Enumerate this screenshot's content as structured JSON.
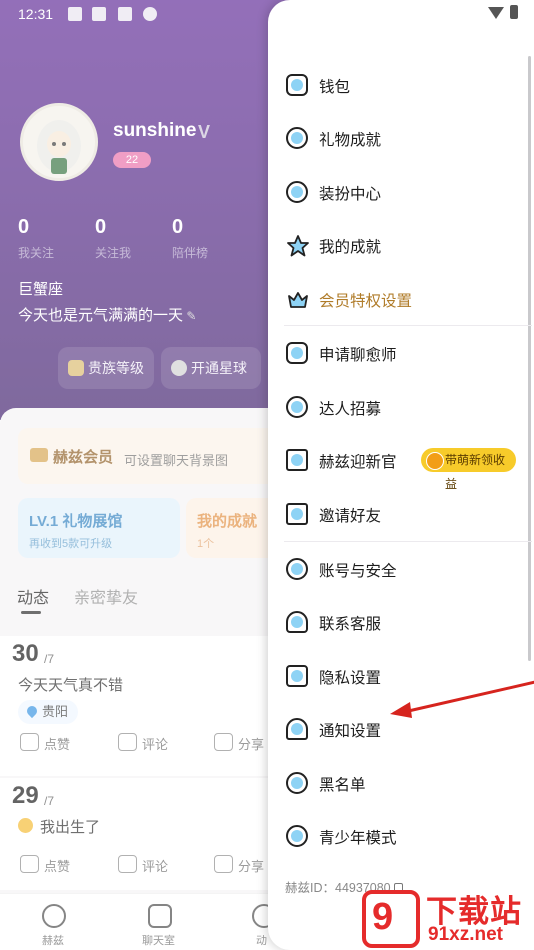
{
  "status_bar": {
    "time": "12:31"
  },
  "profile": {
    "username": "sunshine",
    "level_badge": "22",
    "stats": [
      {
        "value": "0",
        "label": "我关注"
      },
      {
        "value": "0",
        "label": "关注我"
      },
      {
        "value": "0",
        "label": "陪伴榜"
      }
    ],
    "zodiac": "巨蟹座",
    "bio": "今天也是元气满满的一天",
    "pills": [
      "贵族等级",
      "开通星球"
    ]
  },
  "cards": {
    "vip_title": "赫兹会员",
    "vip_sub": "可设置聊天背景图",
    "gift_title": "LV.1 礼物展馆",
    "gift_sub": "再收到5款可升级",
    "ach_title": "我的成就",
    "ach_sub": "1个"
  },
  "tabs": [
    "动态",
    "亲密挚友"
  ],
  "posts": [
    {
      "day": "30",
      "month": "/7",
      "text": "今天天气真不错",
      "location": "贵阳"
    },
    {
      "day": "29",
      "month": "/7",
      "text": "我出生了",
      "location": ""
    }
  ],
  "post_actions": [
    "点赞",
    "评论",
    "分享"
  ],
  "bottom_nav": [
    "赫兹",
    "聊天室",
    "动"
  ],
  "drawer": {
    "items": [
      {
        "label": "钱包",
        "icon": "wallet-icon"
      },
      {
        "label": "礼物成就",
        "icon": "gift-achievement-icon"
      },
      {
        "label": "装扮中心",
        "icon": "dressup-icon"
      },
      {
        "label": "我的成就",
        "icon": "star-icon"
      },
      {
        "label": "会员特权设置",
        "icon": "crown-icon"
      },
      {
        "label": "申请聊愈师",
        "icon": "heart-chat-icon"
      },
      {
        "label": "达人招募",
        "icon": "badge-icon"
      },
      {
        "label": "赫兹迎新官",
        "icon": "newcomer-icon",
        "tag": "带萌新领收益"
      },
      {
        "label": "邀请好友",
        "icon": "invite-icon"
      },
      {
        "label": "账号与安全",
        "icon": "account-icon"
      },
      {
        "label": "联系客服",
        "icon": "headset-icon"
      },
      {
        "label": "隐私设置",
        "icon": "lock-icon"
      },
      {
        "label": "通知设置",
        "icon": "bell-icon"
      },
      {
        "label": "黑名单",
        "icon": "blacklist-icon"
      },
      {
        "label": "青少年模式",
        "icon": "teen-icon"
      }
    ],
    "uid": "赫兹ID：44937080"
  },
  "watermark": {
    "logo": "9",
    "title": "下载站",
    "url": "91xz.net"
  },
  "colors": {
    "header": "#4a1e7e",
    "gold": "#b07c2a",
    "tag": "#f7cb2a",
    "arrow": "#d6241e"
  }
}
